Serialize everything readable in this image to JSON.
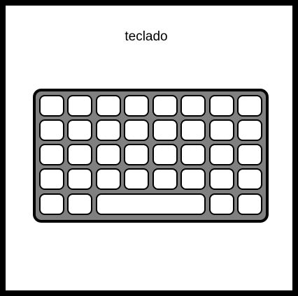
{
  "card": {
    "title": "teclado"
  },
  "keyboard": {
    "icon": "keyboard-icon",
    "colors": {
      "body": "#808080",
      "outline": "#000000",
      "key": "#ffffff"
    },
    "rows": [
      [
        "key",
        "key",
        "key",
        "key",
        "key",
        "key",
        "key",
        "key"
      ],
      [
        "key",
        "key",
        "key",
        "key",
        "key",
        "key",
        "key",
        "key"
      ],
      [
        "key",
        "key",
        "key",
        "key",
        "key",
        "key",
        "key",
        "key"
      ],
      [
        "key",
        "key",
        "key",
        "key",
        "key",
        "key",
        "key",
        "key"
      ],
      [
        "key",
        "key",
        "spacebar",
        "key",
        "key"
      ]
    ]
  }
}
